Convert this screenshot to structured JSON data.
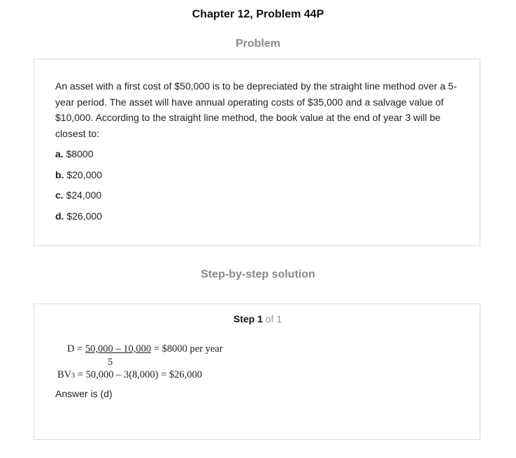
{
  "header": {
    "title": "Chapter 12, Problem 44P"
  },
  "problem": {
    "heading": "Problem",
    "text": "An asset with a first cost of $50,000 is to be depreciated by the straight line method over a 5-year period. The asset will have annual operating costs of $35,000 and a salvage value of $10,000. According to the straight line method, the book value at the end of year 3 will be closest to:",
    "options": [
      {
        "letter": "a.",
        "text": "$8000"
      },
      {
        "letter": "b.",
        "text": "$20,000"
      },
      {
        "letter": "c.",
        "text": "$24,000"
      },
      {
        "letter": "d.",
        "text": "$26,000"
      }
    ]
  },
  "solution": {
    "heading": "Step-by-step solution",
    "step_label": "Step 1",
    "step_of": "of 1",
    "eq1_lhs": "D = ",
    "eq1_numerator": "50,000 – 10,000",
    "eq1_rhs": " = $8000 per year",
    "eq1_denominator": "5",
    "eq2_bv": "BV",
    "eq2_sub": "3",
    "eq2_rhs": " = 50,000 – 3(8,000) = $26,000",
    "answer": "Answer is (d)"
  }
}
